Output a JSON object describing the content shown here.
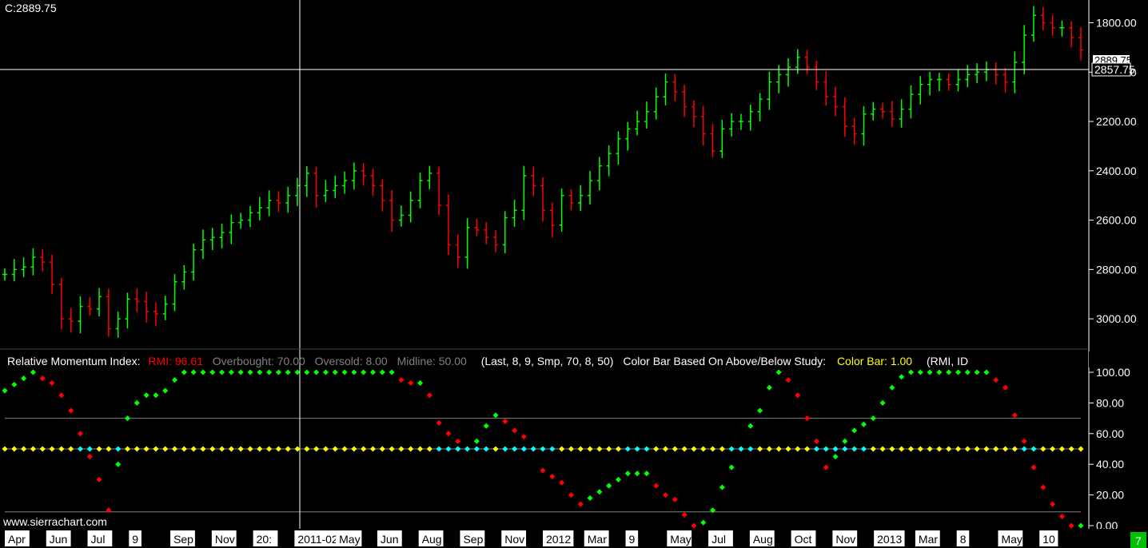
{
  "header": {
    "close_readout": "C:2889.75",
    "watermark": "www.sierrachart.com"
  },
  "price_axis": {
    "ticks": [
      "3000.00",
      "2800.00",
      "2600.00",
      "2400.00",
      "2200.00",
      "2000.00",
      "1800.00"
    ],
    "last_price_box": "2889.75",
    "crosshair_price_box": "2857.75"
  },
  "study": {
    "name": "Relative Momentum Index:",
    "rmi_label": "RMI: 96.61",
    "overbought_label": "Overbought: 70.00",
    "oversold_label": "Oversold: 8.00",
    "midline_label": "Midline: 50.00",
    "params": "(Last, 8, 9, Smp, 70, 8, 50)",
    "colorbar_name": "Color Bar Based On Above/Below Study:",
    "colorbar_value": "Color Bar: 1.00",
    "colorbar_params": "(RMI, ID",
    "ticks": [
      "100.00",
      "80.00",
      "60.00",
      "40.00",
      "20.00",
      "0.00"
    ]
  },
  "time_axis": {
    "labels": [
      "Apr",
      "Jun",
      "Jul",
      "9",
      "Sep",
      "Nov",
      "20:",
      "2011-02-22",
      "May",
      "Jun",
      "Aug",
      "Sep",
      "Nov",
      "2012",
      "Mar",
      "9",
      "May",
      "Jul",
      "Aug",
      "Oct",
      "Nov",
      "2013",
      "Mar",
      "8",
      "May",
      "10"
    ],
    "corner_badge": "7"
  },
  "colors": {
    "background": "#000000",
    "up_bar": "#00ff00",
    "down_bar": "#ff0000",
    "midline_dot": "#ffff00",
    "neutral_dot": "#00ffff",
    "rmi_label": "#ff0000",
    "colorbar_value": "#ffff00",
    "muted_label": "#808080",
    "corner_badge": "#00c000"
  },
  "chart_data": [
    {
      "type": "ohlc",
      "title": "",
      "ylim": [
        1700,
        3060
      ],
      "y_ticks": [
        1800,
        2000,
        2200,
        2400,
        2600,
        2800,
        3000
      ],
      "x_range": [
        "2010-04",
        "2013-06"
      ],
      "series": [
        {
          "values": [
            1980,
            2000,
            2010,
            2050,
            2030,
            1940,
            1800,
            1790,
            1850,
            1840,
            1890,
            1760,
            1800,
            1880,
            1870,
            1830,
            1820,
            1860,
            1950,
            1990,
            2080,
            2120,
            2130,
            2150,
            2190,
            2200,
            2230,
            2250,
            2280,
            2270,
            2300,
            2340,
            2390,
            2300,
            2320,
            2340,
            2360,
            2400,
            2380,
            2340,
            2280,
            2200,
            2220,
            2280,
            2360,
            2390,
            2260,
            2100,
            2050,
            2170,
            2160,
            2130,
            2100,
            2210,
            2240,
            2380,
            2340,
            2240,
            2180,
            2300,
            2270,
            2300,
            2360,
            2420,
            2470,
            2530,
            2570,
            2600,
            2640,
            2700,
            2760,
            2720,
            2660,
            2620,
            2550,
            2480,
            2570,
            2600,
            2600,
            2640,
            2690,
            2760,
            2790,
            2820,
            2860,
            2820,
            2760,
            2700,
            2660,
            2580,
            2550,
            2630,
            2650,
            2640,
            2610,
            2650,
            2710,
            2750,
            2770,
            2770,
            2750,
            2770,
            2790,
            2800,
            2810,
            2790,
            2760,
            2840,
            2950,
            3030,
            3000,
            2980,
            2980,
            2940,
            2889.75
          ]
        }
      ]
    },
    {
      "type": "scatter",
      "title": "Relative Momentum Index",
      "ylim": [
        0,
        100
      ],
      "y_ticks": [
        0,
        20,
        40,
        60,
        80,
        100
      ],
      "overbought": 70,
      "oversold": 8,
      "midline": 50,
      "series": [
        {
          "name": "RMI",
          "values": [
            88,
            92,
            96,
            100,
            96,
            93,
            85,
            75,
            60,
            45,
            30,
            10,
            40,
            70,
            80,
            85,
            85,
            88,
            95,
            100,
            100,
            100,
            100,
            100,
            100,
            100,
            100,
            100,
            100,
            100,
            100,
            100,
            100,
            100,
            100,
            100,
            100,
            100,
            100,
            100,
            100,
            100,
            95,
            93,
            93,
            85,
            67,
            60,
            55,
            50,
            55,
            65,
            72,
            68,
            62,
            58,
            50,
            36,
            32,
            28,
            20,
            14,
            18,
            22,
            26,
            30,
            34,
            34,
            34,
            26,
            20,
            17,
            7,
            0,
            2,
            10,
            25,
            38,
            50,
            65,
            75,
            90,
            100,
            95,
            85,
            70,
            55,
            38,
            45,
            55,
            62,
            66,
            70,
            80,
            90,
            97,
            100,
            100,
            100,
            100,
            100,
            100,
            100,
            100,
            100,
            95,
            90,
            72,
            55,
            38,
            25,
            14,
            6,
            0,
            0
          ]
        },
        {
          "name": "Color Bar",
          "values": [
            50,
            50,
            50,
            50,
            50,
            50,
            50,
            50,
            50,
            50,
            50,
            50,
            50,
            50,
            50,
            50,
            50,
            50,
            50,
            50,
            50,
            50,
            50,
            50,
            50,
            50,
            50,
            50,
            50,
            50,
            50,
            50,
            50,
            50,
            50,
            50,
            50,
            50,
            50,
            50,
            50,
            50,
            50,
            50,
            50,
            50,
            50,
            50,
            50,
            50,
            50,
            50,
            50,
            50,
            50,
            50,
            50,
            50,
            50,
            50,
            50,
            50,
            50,
            50,
            50,
            50,
            50,
            50,
            50,
            50,
            50,
            50,
            50,
            50,
            50,
            50,
            50,
            50,
            50,
            50,
            50,
            50,
            50,
            50,
            50,
            50,
            50,
            50,
            50,
            50,
            50,
            50,
            50,
            50,
            50,
            50,
            50,
            50,
            50,
            50,
            50,
            50,
            50,
            50,
            50,
            50,
            50,
            50,
            50,
            50,
            50,
            50,
            50,
            50,
            50
          ]
        }
      ]
    }
  ]
}
